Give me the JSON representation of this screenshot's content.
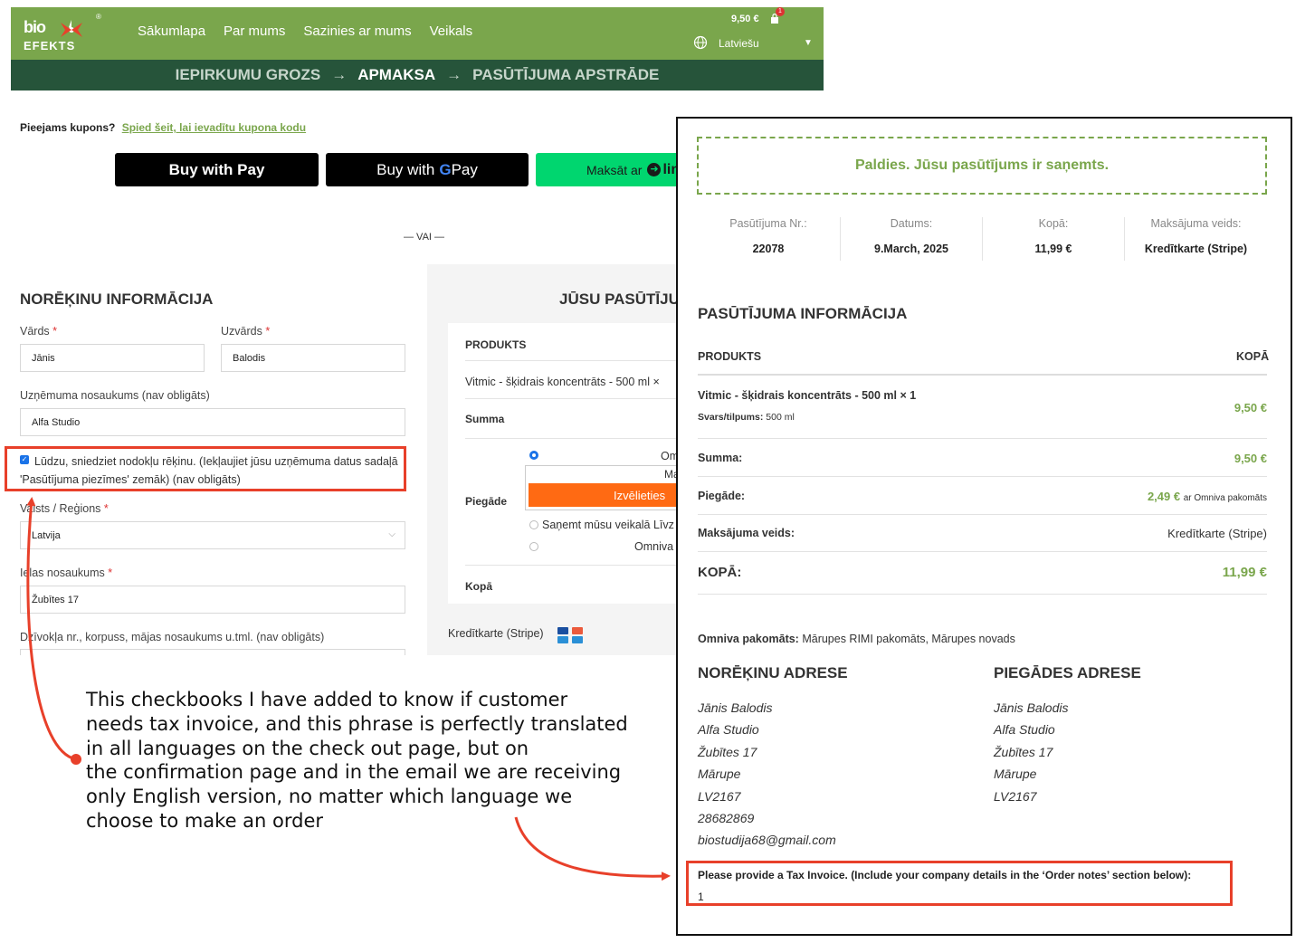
{
  "header": {
    "logo_top": "bio",
    "logo_bottom": "EFEKTS",
    "logo_reg": "®",
    "nav": [
      "Sākumlapa",
      "Par mums",
      "Sazinies ar mums",
      "Veikals"
    ],
    "cart_total": "9,50 €",
    "cart_count": "1",
    "language": "Latviešu",
    "steps": [
      "IEPIRKUMU GROZS",
      "APMAKSA",
      "PASŪTĪJUMA APSTRĀDE"
    ],
    "step_arrow": "→",
    "brand_color": "#7aa64c",
    "steps_bg": "#26543a"
  },
  "checkout": {
    "coupon_q": "Pieejams kupons?",
    "coupon_link": "Spied šeit, lai ievadītu kupona kodu",
    "apple_pay": "Buy with  Pay",
    "google_pay_pre": "Buy with",
    "google_pay_post": "Pay",
    "link_pay": "Maksāt ar",
    "link_brand": "lin",
    "or": "— VAI —",
    "billing_title": "NORĒĶINU INFORMĀCIJA",
    "first_name_label": "Vārds",
    "first_name": "Jānis",
    "last_name_label": "Uzvārds",
    "last_name": "Balodis",
    "company_label": "Uzņēmuma nosaukums (nav obligāts)",
    "company": "Alfa Studio",
    "tax_invoice": "Lūdzu, sniedziet nodokļu rēķinu. (Iekļaujiet jūsu uzņēmuma datus sadaļā 'Pasūtījuma piezīmes' zemāk) (nav obligāts)",
    "country_label": "Valsts / Reģions",
    "country": "Latvija",
    "street_label": "Ielas nosaukums",
    "street": "Žubītes 17",
    "apartment_label": "Dzīvokļa nr., korpuss, mājas nosaukums u.tml. (nav obligāts)",
    "required_mark": "*"
  },
  "summary": {
    "title": "JŪSU PASŪTĪJU",
    "col_product": "PRODUKTS",
    "item": "Vitmic - šķidrais koncentrāts - 500 ml  ×",
    "subtotal": "Summa",
    "shipping": "Piegāde",
    "opt_omniva": "Om",
    "opt_omniva_line2": "Ma",
    "choose_btn": "Izvēlieties",
    "opt_pickup": "Saņemt mūsu veikalā Līvz",
    "opt_omniva2": "Omniva",
    "total": "Kopā",
    "payment": "Kredītkarte (Stripe)"
  },
  "confirmation": {
    "thanks": "Paldies. Jūsu pasūtījums ir saņemts.",
    "meta": [
      {
        "k": "Pasūtījuma Nr.:",
        "v": "22078"
      },
      {
        "k": "Datums:",
        "v": "9.March, 2025"
      },
      {
        "k": "Kopā:",
        "v": "11,99 €"
      },
      {
        "k": "Maksājuma veids:",
        "v": "Kredītkarte (Stripe)"
      }
    ],
    "order_title": "PASŪTĪJUMA INFORMĀCIJA",
    "col_product": "PRODUKTS",
    "col_total": "KOPĀ",
    "item": "Vitmic - šķidrais koncentrāts - 500 ml",
    "item_qty": "× 1",
    "item_meta_k": "Svars/tilpums:",
    "item_meta_v": "500 ml",
    "item_price": "9,50 €",
    "subtotal_k": "Summa:",
    "subtotal_v": "9,50 €",
    "shipping_k": "Piegāde:",
    "shipping_v": "2,49 €",
    "shipping_via": "ar Omniva pakomāts",
    "payment_k": "Maksājuma veids:",
    "payment_v": "Kredītkarte (Stripe)",
    "total_k": "KOPĀ:",
    "total_v": "11,99 €",
    "omniva_k": "Omniva pakomāts:",
    "omniva_v": "Mārupes RIMI pakomāts, Mārupes novads",
    "billing_title": "NORĒĶINU ADRESE",
    "shipping_title": "PIEGĀDES ADRESE",
    "billing_lines": [
      "Jānis Balodis",
      "Alfa Studio",
      "Žubītes 17",
      "Mārupe",
      "LV2167",
      "28682869",
      "biostudija68@gmail.com"
    ],
    "shipping_lines": [
      "Jānis Balodis",
      "Alfa Studio",
      "Žubītes 17",
      "Mārupe",
      "LV2167"
    ],
    "tax_note": "Please provide a Tax Invoice. (Include your company details in the ‘Order notes’ section below):",
    "tax_note_value": "1"
  },
  "annotation": {
    "text": "This checkbooks I have added to know if customer needs tax invoice, and this phrase is perfectly translated in all languages on the check out page, but on the confirmation page and in the email we are receiving only English version, no matter which language we choose to make an order",
    "lines": [
      "This checkbooks I have added to know if customer",
      "needs tax invoice, and this phrase is perfectly translated",
      "in all languages on the check out page, but on",
      "the confirmation page and in the email we are receiving",
      "only English version, no matter which language we",
      "choose to make an order"
    ],
    "highlight_color": "#e8402a"
  }
}
